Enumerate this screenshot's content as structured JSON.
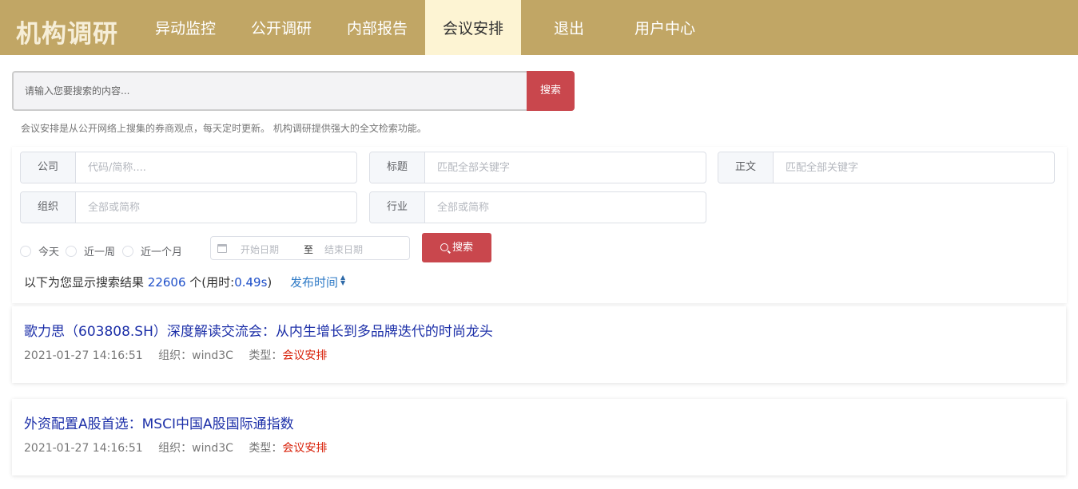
{
  "logo": "机构调研",
  "nav": [
    {
      "label": "异动监控",
      "active": false
    },
    {
      "label": "公开调研",
      "active": false
    },
    {
      "label": "内部报告",
      "active": false
    },
    {
      "label": "会议安排",
      "active": true
    },
    {
      "label": "退出",
      "active": false
    },
    {
      "label": "用户中心",
      "active": false
    }
  ],
  "search": {
    "placeholder": "请输入您要搜索的内容...",
    "button": "搜索",
    "note": "会议安排是从公开网络上搜集的券商观点，每天定时更新。 机构调研提供强大的全文检索功能。"
  },
  "filters": {
    "company": {
      "label": "公司",
      "placeholder": "代码/简称...."
    },
    "title": {
      "label": "标题",
      "placeholder": "匹配全部关键字"
    },
    "body": {
      "label": "正文",
      "placeholder": "匹配全部关键字"
    },
    "org": {
      "label": "组织",
      "placeholder": "全部或简称"
    },
    "industry": {
      "label": "行业",
      "placeholder": "全部或简称"
    },
    "periods": [
      "今天",
      "近一周",
      "近一个月"
    ],
    "date_start": "开始日期",
    "date_sep": "至",
    "date_end": "结束日期",
    "button": "搜索"
  },
  "summary": {
    "prefix": "以下为您显示搜索结果",
    "count": "22606",
    "suffix": "个(用时:",
    "time": "0.49s",
    "close": ")",
    "sort_label": "发布时间"
  },
  "results": [
    {
      "title": "歌力思（603808.SH）深度解读交流会：从内生增长到多品牌迭代的时尚龙头",
      "datetime": "2021-01-27 14:16:51",
      "org_label": "组织：",
      "org": "wind3C",
      "type_label": "类型：",
      "type": "会议安排"
    },
    {
      "title": "外资配置A股首选：MSCI中国A股国际通指数",
      "datetime": "2021-01-27 14:16:51",
      "org_label": "组织：",
      "org": "wind3C",
      "type_label": "类型：",
      "type": "会议安排"
    }
  ],
  "colors": {
    "nav_bg": "#c1a665",
    "nav_active": "#fdf4d3",
    "button": "#c9474d",
    "link": "#1c2fa8",
    "type": "#d81e06"
  }
}
